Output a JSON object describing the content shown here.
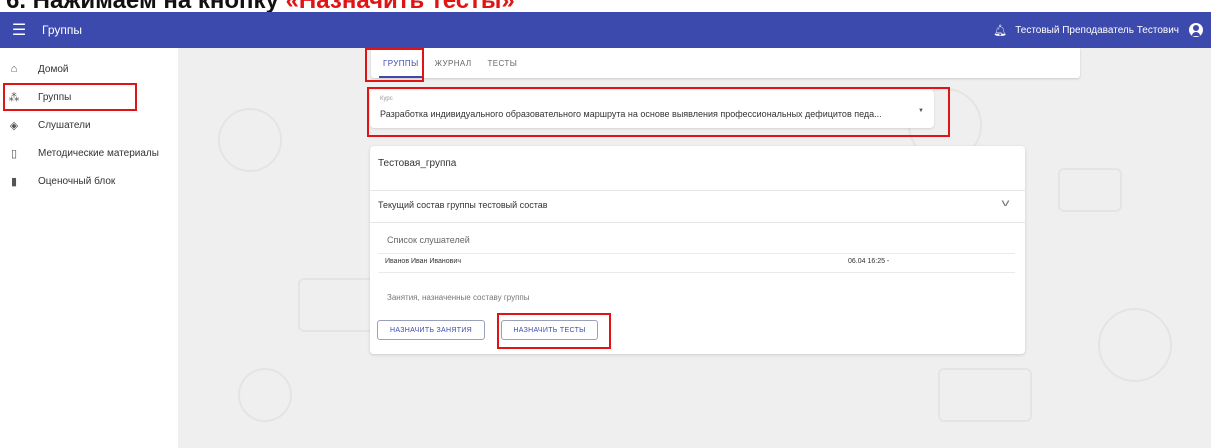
{
  "caption": {
    "prefix": "6. Нажимаем на кнопку ",
    "highlight": "«Назначить тесты»"
  },
  "appbar": {
    "title": "Группы",
    "user": "Тестовый Преподаватель Тестович"
  },
  "sidebar": {
    "items": [
      {
        "label": "Домой",
        "icon": "home-icon"
      },
      {
        "label": "Группы",
        "icon": "groups-icon"
      },
      {
        "label": "Слушатели",
        "icon": "graduation-cap-icon"
      },
      {
        "label": "Методические материалы",
        "icon": "document-icon"
      },
      {
        "label": "Оценочный блок",
        "icon": "test-tube-icon"
      }
    ]
  },
  "tabs": [
    {
      "label": "ГРУППЫ"
    },
    {
      "label": "ЖУРНАЛ"
    },
    {
      "label": "ТЕСТЫ"
    }
  ],
  "course": {
    "label": "Курс",
    "value": "Разработка индивидуального образовательного маршрута на основе выявления профессиональных дефицитов педа..."
  },
  "group": {
    "title": "Тестовая_группа",
    "composition_title": "Текущий состав группы тестовый состав",
    "students_label": "Список слушателей",
    "students": [
      {
        "name": "Иванов Иван Иванович",
        "date": "06.04 16:25 -"
      }
    ],
    "lessons_label": "Занятия, назначенные составу группы",
    "assign_lessons_button": "НАЗНАЧИТЬ ЗАНЯТИЯ",
    "assign_tests_button": "НАЗНАЧИТЬ ТЕСТЫ"
  },
  "colors": {
    "primary": "#3d4aad",
    "highlight": "#e01414",
    "background": "#efefef"
  }
}
